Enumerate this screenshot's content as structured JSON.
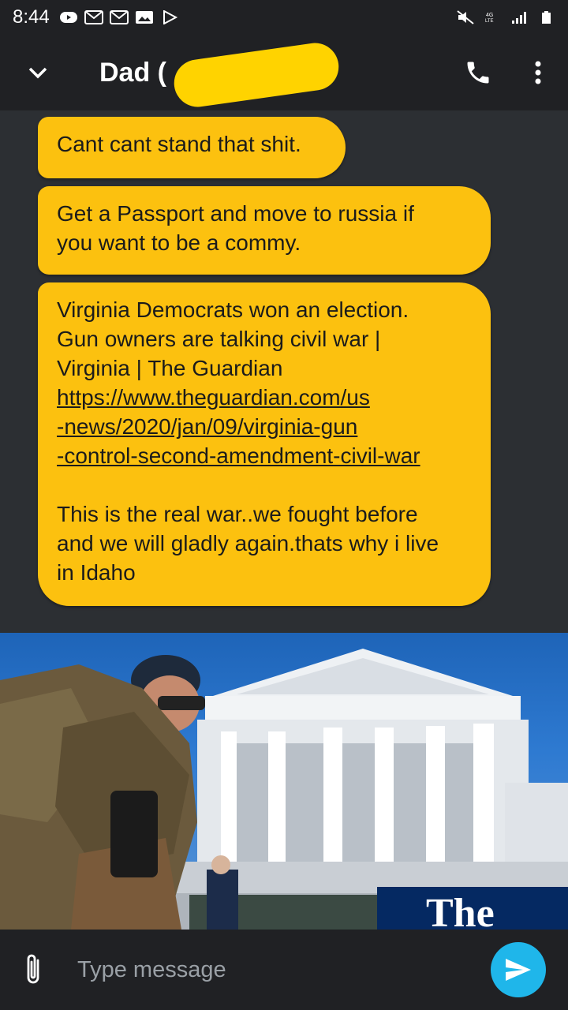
{
  "status_bar": {
    "time": "8:44",
    "left_icons": [
      "video-icon",
      "gmail-icon",
      "gmail-icon",
      "image-icon",
      "play-store-icon"
    ],
    "right_icons": [
      "mute-icon",
      "4g-lte-icon",
      "signal-icon",
      "battery-icon"
    ]
  },
  "header": {
    "contact_name": "Dad (",
    "contact_name_suffix": ")",
    "call_icon": "phone-icon",
    "menu_icon": "more-vert-icon"
  },
  "messages": [
    {
      "text": "Cant cant stand that shit."
    },
    {
      "text": "Get a Passport and move to russia if\nyou want to be a commy."
    },
    {
      "text_before": "Virginia Democrats won an election.\nGun owners are talking civil war |\nVirginia | The Guardian\n",
      "link": "https://www.theguardian.com/us\n-news/2020/jan/09/virginia-gun\n-control-second-amendment-civil-war",
      "text_after": "\n\nThis is the real war..we fought before\nand we will gladly again.thats why i live\nin Idaho"
    }
  ],
  "preview": {
    "logo_text": "The"
  },
  "composer": {
    "placeholder": "Type message",
    "attach_icon": "paperclip-icon",
    "send_icon": "send-icon"
  },
  "colors": {
    "bubble": "#fcc10f",
    "background": "#2c2f33",
    "bar": "#202124",
    "send": "#1fb6ea",
    "redaction": "#ffd300"
  }
}
